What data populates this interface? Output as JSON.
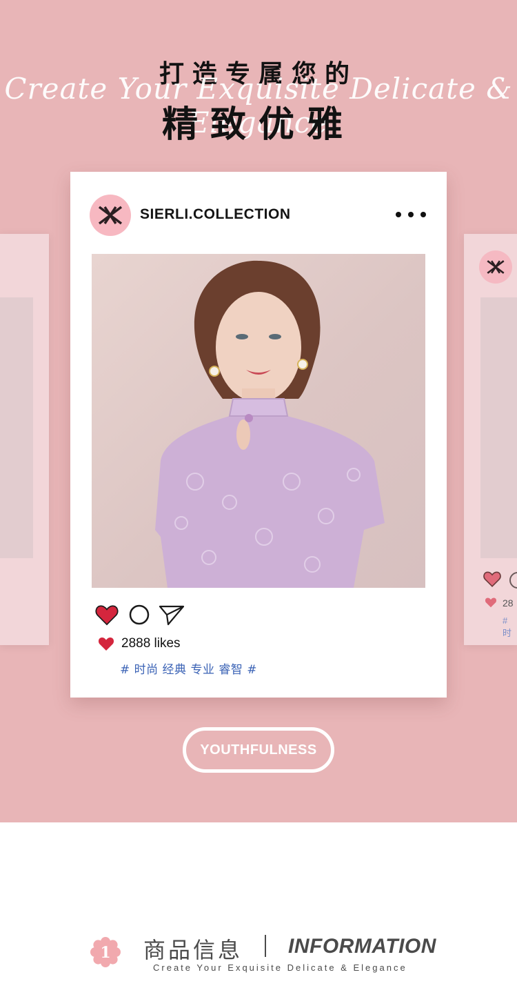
{
  "hero": {
    "title_line1": "打造专属您的",
    "script_text": "Create Your Exquisite Delicate & Elegance",
    "title_line2": "精致优雅"
  },
  "post": {
    "username": "SIERLI.COLLECTION",
    "likes": "2888 likes",
    "tags": "# 时尚 经典 专业 睿智 #"
  },
  "side_card_right": {
    "likes_partial": "28",
    "tags_partial": "# 时"
  },
  "cta": {
    "label": "YOUTHFULNESS"
  },
  "info": {
    "badge_number": "1",
    "title_cn": "商品信息",
    "title_en": "INFORMATION",
    "subtitle": "Create Your Exquisite Delicate & Elegance"
  },
  "colors": {
    "background_pink": "#e8b5b7",
    "side_card": "#f2d6d9",
    "avatar_pink": "#f7b8c1",
    "heart_red": "#d4263d",
    "tag_blue": "#3a62b5",
    "heading_gray": "#4a4a4a"
  },
  "icons": [
    "logo-icon",
    "more-icon",
    "heart-icon",
    "comment-icon",
    "share-icon",
    "flower-badge-icon"
  ]
}
